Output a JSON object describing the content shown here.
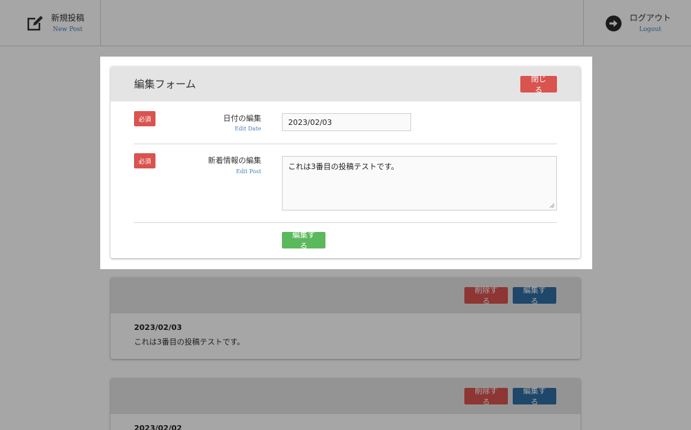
{
  "header": {
    "new_post": {
      "label_ja": "新規投稿",
      "label_en": "New Post",
      "icon": "edit-icon"
    },
    "logout": {
      "label_ja": "ログアウト",
      "label_en": "Logout",
      "icon": "arrow-right-circle-icon"
    }
  },
  "posts": [
    {
      "date": "2023/02/03",
      "text": "これは3番目の投稿テストです。",
      "delete_label": "削除する",
      "edit_label": "編集する"
    },
    {
      "date": "2023/02/02",
      "text": "",
      "delete_label": "削除する",
      "edit_label": "編集する"
    }
  ],
  "modal": {
    "title": "編集フォーム",
    "close_label": "閉じる",
    "required_badge": "必須",
    "date_field": {
      "label_ja": "日付の編集",
      "label_en": "Edit Date",
      "value": "2023/02/03"
    },
    "post_field": {
      "label_ja": "新着情報の編集",
      "label_en": "Edit Post",
      "value": "これは3番目の投稿テストです。"
    },
    "submit_label": "編集する"
  },
  "colors": {
    "danger": "#d9534f",
    "primary": "#2e6da4",
    "success": "#5cb85c",
    "link": "#4a7fb8"
  }
}
